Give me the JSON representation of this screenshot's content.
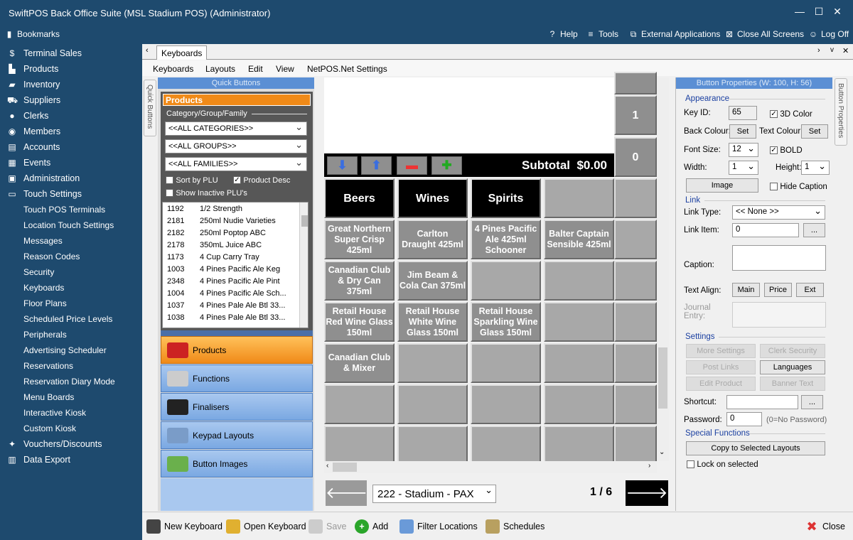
{
  "window": {
    "title": "SwiftPOS Back Office Suite (MSL Stadium POS) (Administrator)"
  },
  "topbar": {
    "bookmarks": "Bookmarks",
    "help": "Help",
    "tools": "Tools",
    "external": "External Applications",
    "close_all": "Close All Screens",
    "logoff": "Log Off"
  },
  "sidebar": {
    "items": [
      "Terminal Sales",
      "Products",
      "Inventory",
      "Suppliers",
      "Clerks",
      "Members",
      "Accounts",
      "Events",
      "Administration",
      "Touch Settings"
    ],
    "subitems": [
      "Touch POS Terminals",
      "Location Touch Settings",
      "Messages",
      "Reason Codes",
      "Security",
      "Keyboards",
      "Floor Plans",
      "Scheduled Price Levels",
      "Peripherals",
      "Advertising Scheduler",
      "Reservations",
      "Reservation Diary Mode",
      "Menu Boards",
      "Interactive Kiosk",
      "Custom Kiosk"
    ],
    "after": [
      "Vouchers/Discounts",
      "Data Export"
    ]
  },
  "tab": {
    "label": "Keyboards"
  },
  "menu": [
    "Keyboards",
    "Layouts",
    "Edit",
    "View",
    "NetPOS.Net Settings"
  ],
  "quick": {
    "header": "Quick Buttons",
    "vtab": "Quick Buttons",
    "panel_title": "Products",
    "cgf_label": "Category/Group/Family",
    "categories": "<<ALL CATEGORIES>>",
    "groups": "<<ALL GROUPS>>",
    "families": "<<ALL FAMILIES>>",
    "sort_plu": "Sort by PLU",
    "prod_desc": "Product Desc",
    "show_inactive": "Show Inactive PLU's",
    "plus": [
      [
        "1192",
        "1/2 Strength"
      ],
      [
        "2181",
        "250ml Nudie Varieties"
      ],
      [
        "2182",
        "250ml Poptop ABC"
      ],
      [
        "2178",
        "350mL Juice ABC"
      ],
      [
        "1173",
        "4 Cup Carry Tray"
      ],
      [
        "1003",
        "4 Pines Pacific Ale Keg"
      ],
      [
        "2348",
        "4 Pines Pacific Ale Pint"
      ],
      [
        "1004",
        "4 Pines Pacific Ale Sch..."
      ],
      [
        "1037",
        "4 Pines Pale Ale Btl 33..."
      ],
      [
        "1038",
        "4 Pines Pale Ale Btl 33..."
      ]
    ],
    "cats": [
      "Products",
      "Functions",
      "Finalisers",
      "Keypad Layouts",
      "Button Images"
    ]
  },
  "keyboard": {
    "subtotal": "Subtotal  $0.00",
    "right_col": [
      "1",
      "0"
    ],
    "rows": [
      [
        "Beers",
        "Wines",
        "Spirits",
        ""
      ],
      [
        "Great Northern Super Crisp 425ml",
        "Carlton Draught 425ml",
        "4 Pines Pacific Ale 425ml Schooner",
        "Balter Captain Sensible 425ml"
      ],
      [
        "Canadian Club & Dry Can 375ml",
        "Jim Beam & Cola Can 375ml",
        "",
        ""
      ],
      [
        "Retail House Red Wine Glass 150ml",
        "Retail House White Wine Glass 150ml",
        "Retail House Sparkling Wine Glass 150ml",
        ""
      ],
      [
        "Canadian Club & Mixer",
        "",
        "",
        ""
      ],
      [
        "",
        "",
        "",
        ""
      ],
      [
        "",
        "",
        "",
        ""
      ]
    ],
    "layout_select": "222 - Stadium - PAX",
    "page": "1 / 6"
  },
  "props": {
    "header": "Button Properties (W: 100, H: 56)",
    "vtab": "Button Properties",
    "appearance": "Appearance",
    "key_id_label": "Key ID:",
    "key_id": "65",
    "color3d": "3D Color",
    "back_colour": "Back Colour:",
    "text_colour": "Text Colour:",
    "set": "Set",
    "font_size_label": "Font Size:",
    "font_size": "12",
    "bold": "BOLD",
    "width_label": "Width:",
    "width": "1",
    "height_label": "Height:",
    "height": "1",
    "image": "Image",
    "hide_caption": "Hide Caption",
    "link": "Link",
    "link_type_label": "Link Type:",
    "link_type": "<< None >>",
    "link_item_label": "Link Item:",
    "link_item": "0",
    "ellipsis": "...",
    "caption_label": "Caption:",
    "text_align_label": "Text Align:",
    "align_main": "Main",
    "align_price": "Price",
    "align_ext": "Ext",
    "journal_label": "Journal Entry:",
    "settings": "Settings",
    "more_settings": "More Settings",
    "clerk_security": "Clerk Security",
    "post_links": "Post Links",
    "languages": "Languages",
    "edit_product": "Edit Product",
    "banner_text": "Banner Text",
    "shortcut_label": "Shortcut:",
    "password_label": "Password:",
    "password": "0",
    "no_password": "(0=No Password)",
    "special": "Special Functions",
    "copy_layouts": "Copy to Selected Layouts",
    "lock_selected": "Lock on selected"
  },
  "bottom": {
    "new": "New Keyboard",
    "open": "Open Keyboard",
    "save": "Save",
    "add": "Add",
    "filter": "Filter Locations",
    "schedules": "Schedules",
    "close": "Close"
  },
  "colors": {
    "sidebar": "#1e4a6e",
    "accent_orange": "#f08a18",
    "blue_tab": "#5b8fd4"
  }
}
